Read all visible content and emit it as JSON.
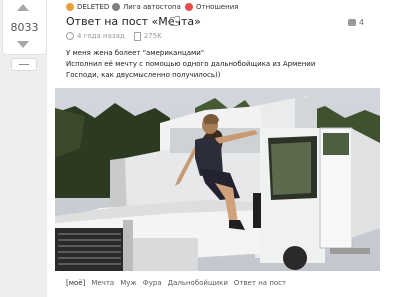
{
  "vote": {
    "score": "8033"
  },
  "header": {
    "author": "DELETED",
    "community": "Лига автостопа",
    "tag": "Отношения"
  },
  "post": {
    "title": "Ответ на пост «Мечта»",
    "time": "4 года назад",
    "saves": "275K",
    "comments": "4",
    "lines": [
      "У меня жена болеет \"американцами\"",
      "Исполнил её мечту с помощью одного дальнобойщика из Армении",
      "Господи, как двусмысленно получилось))"
    ]
  },
  "tags": [
    "[моё]",
    "Мечта",
    "Муж",
    "Фура",
    "Дальнобойщики",
    "Ответ на пост"
  ],
  "colors": {
    "accent": "#e64e4e",
    "muted": "#9a9a9a"
  }
}
